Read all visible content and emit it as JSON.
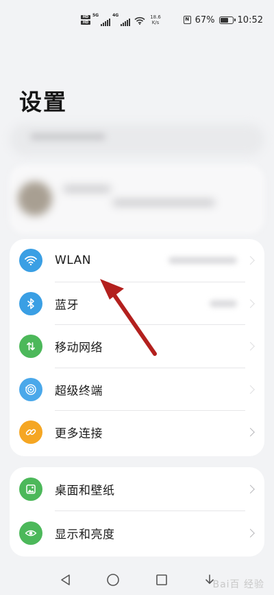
{
  "status_bar": {
    "sim_badge_1": "HD",
    "sim_badge_2": "HD",
    "network_type_1": "5G",
    "network_type_2": "4G",
    "speed_value": "18.6",
    "speed_unit": "K/s",
    "nfc_label": "N",
    "battery_percent": "67%",
    "battery_level": 0.67,
    "time": "10:52"
  },
  "page": {
    "title": "设置"
  },
  "connectivity": {
    "items": [
      {
        "label": "WLAN",
        "icon": "wifi-icon",
        "color": "#3a9fe4"
      },
      {
        "label": "蓝牙",
        "icon": "bluetooth-icon",
        "color": "#3a9fe4"
      },
      {
        "label": "移动网络",
        "icon": "mobile-data-icon",
        "color": "#4cb85a"
      },
      {
        "label": "超级终端",
        "icon": "super-device-icon",
        "color": "#4aa8ea"
      },
      {
        "label": "更多连接",
        "icon": "link-icon",
        "color": "#f5a623"
      }
    ]
  },
  "display": {
    "items": [
      {
        "label": "桌面和壁纸",
        "icon": "wallpaper-icon",
        "color": "#4cb85a"
      },
      {
        "label": "显示和亮度",
        "icon": "eye-icon",
        "color": "#4cb85a"
      }
    ]
  },
  "nav_bar": {
    "back": "back-icon",
    "home": "home-icon",
    "recents": "recents-icon",
    "down": "down-icon"
  },
  "watermark": {
    "text": "Bai百 经验"
  },
  "colors": {
    "background": "#f2f3f5",
    "card": "#ffffff",
    "annotation_arrow": "#b3201e"
  }
}
